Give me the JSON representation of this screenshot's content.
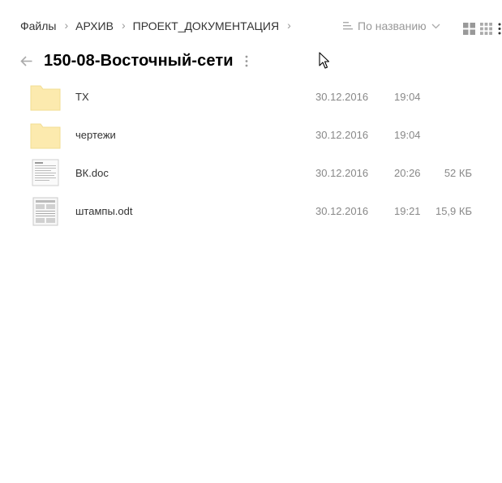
{
  "breadcrumbs": [
    {
      "label": "Файлы"
    },
    {
      "label": "АРХИВ"
    },
    {
      "label": "ПРОЕКТ_ДОКУМЕНТАЦИЯ"
    }
  ],
  "sort": {
    "label": "По названию",
    "icon": "sort-lines-icon"
  },
  "views": {
    "large_icon": "grid-large-icon",
    "small_icon": "grid-small-icon",
    "more_icon": "kebab-icon"
  },
  "folder": {
    "title": "150-08-Восточный-сети"
  },
  "files": [
    {
      "name": "ТХ",
      "date": "30.12.2016",
      "time": "19:04",
      "size": "",
      "kind": "folder"
    },
    {
      "name": "чертежи",
      "date": "30.12.2016",
      "time": "19:04",
      "size": "",
      "kind": "folder"
    },
    {
      "name": "ВК.doc",
      "date": "30.12.2016",
      "time": "20:26",
      "size": "52 КБ",
      "kind": "document"
    },
    {
      "name": "штампы.odt",
      "date": "30.12.2016",
      "time": "19:21",
      "size": "15,9 КБ",
      "kind": "spreadsheet-doc"
    }
  ],
  "colors": {
    "folder_fill": "#FCEAAE",
    "folder_stroke": "#F2DD92",
    "muted_text": "#888888",
    "icon_gray": "#AAAAAA"
  }
}
